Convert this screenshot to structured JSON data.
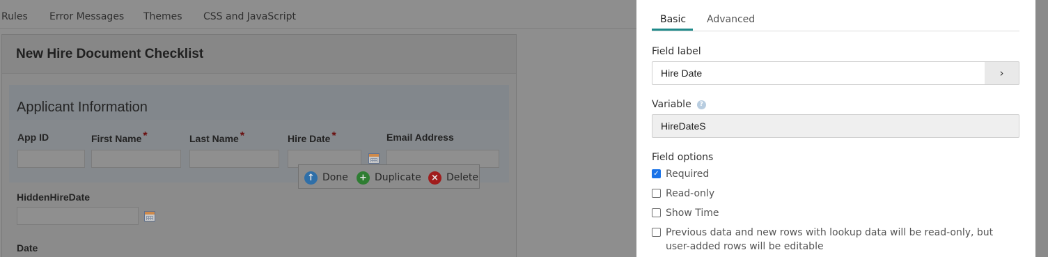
{
  "nav": {
    "items": [
      "Rules",
      "Error Messages",
      "Themes",
      "CSS and JavaScript"
    ]
  },
  "form": {
    "title": "New Hire Document Checklist",
    "section_title": "Applicant Information",
    "fields": {
      "app_id": "App ID",
      "first_name": "First Name",
      "last_name": "Last Name",
      "hire_date": "Hire Date",
      "email": "Email Address",
      "hidden_hire_date": "HiddenHireDate",
      "date": "Date"
    },
    "required_marker": "*"
  },
  "toolbar": {
    "done": "Done",
    "duplicate": "Duplicate",
    "delete": "Delete"
  },
  "panel": {
    "tabs": [
      "Basic",
      "Advanced"
    ],
    "active_tab": "Basic",
    "field_label_title": "Field label",
    "field_label_value": "Hire Date",
    "variable_title": "Variable",
    "variable_value": "HireDateS",
    "field_options_title": "Field options",
    "options": [
      {
        "label": "Required",
        "checked": true
      },
      {
        "label": "Read-only",
        "checked": false
      },
      {
        "label": "Show Time",
        "checked": false
      },
      {
        "label": "Previous data and new rows with lookup data will be read-only, but user-added rows will be editable",
        "checked": false
      }
    ]
  },
  "colors": {
    "tab_accent": "#1f8a8a",
    "checkbox_checked": "#1a73e8",
    "required_star": "#8b0000",
    "done_icon": "#2f6fa8",
    "duplicate_icon": "#2e7d32",
    "delete_icon": "#a01c1c"
  },
  "icons": {
    "calendar": "calendar-icon",
    "done": "arrow-up-circle-icon",
    "duplicate": "plus-circle-icon",
    "delete": "x-circle-icon",
    "chevron": "chevron-right-icon",
    "help": "question-circle-icon"
  }
}
